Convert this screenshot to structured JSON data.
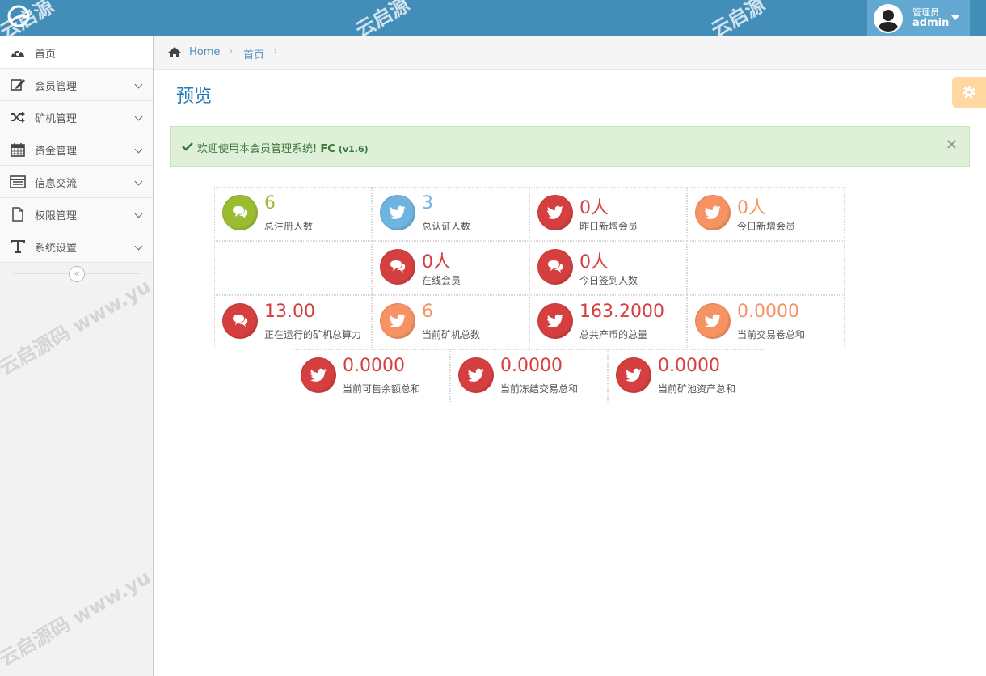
{
  "header": {
    "user_role": "管理员",
    "user_name": "admin"
  },
  "watermarks": [
    "云启源",
    "云启源",
    "云启源",
    "云启源码 www.yu",
    "云启源码 www.yu"
  ],
  "sidebar": {
    "items": [
      {
        "label": "首页",
        "icon": "dashboard-icon"
      },
      {
        "label": "会员管理",
        "icon": "edit-icon"
      },
      {
        "label": "矿机管理",
        "icon": "shuffle-icon"
      },
      {
        "label": "资金管理",
        "icon": "calendar-icon"
      },
      {
        "label": "信息交流",
        "icon": "list-icon"
      },
      {
        "label": "权限管理",
        "icon": "file-icon"
      },
      {
        "label": "系统设置",
        "icon": "text-icon"
      }
    ],
    "collapse_icon": "«"
  },
  "breadcrumb": {
    "home": "Home",
    "current": "首页",
    "separator": "›"
  },
  "page": {
    "title": "预览"
  },
  "alert": {
    "text": "欢迎使用本会员管理系统!",
    "brand": "FC",
    "version": "(v1.6)",
    "close": "×"
  },
  "stats": [
    {
      "value": "6",
      "label": "总注册人数",
      "color": "#9abc32",
      "icon": "comments-icon"
    },
    {
      "value": "3",
      "label": "总认证人数",
      "color": "#6fb3e0",
      "icon": "twitter-icon"
    },
    {
      "value": "0人",
      "label": "昨日新增会员",
      "color": "#d53f40",
      "icon": "twitter-icon"
    },
    {
      "value": "0人",
      "label": "今日新增会员",
      "color": "#f79263",
      "icon": "twitter-icon"
    },
    {
      "value": "0人",
      "label": "在线会员",
      "color": "#d53f40",
      "icon": "comments-icon"
    },
    {
      "value": "0人",
      "label": "今日签到人数",
      "color": "#d53f40",
      "icon": "comments-icon"
    },
    {
      "value": "13.00",
      "label": "正在运行的矿机总算力",
      "color": "#d53f40",
      "icon": "comments-icon"
    },
    {
      "value": "6",
      "label": "当前矿机总数",
      "color": "#f79263",
      "icon": "twitter-icon"
    },
    {
      "value": "163.2000",
      "label": "总共产币的总量",
      "color": "#d53f40",
      "icon": "twitter-icon"
    },
    {
      "value": "0.0000",
      "label": "当前交易卷总和",
      "color": "#f79263",
      "icon": "twitter-icon"
    },
    {
      "value": "0.0000",
      "label": "当前可售余额总和",
      "color": "#d53f40",
      "icon": "twitter-icon"
    },
    {
      "value": "0.0000",
      "label": "当前冻结交易总和",
      "color": "#d53f40",
      "icon": "twitter-icon"
    },
    {
      "value": "0.0000",
      "label": "当前矿池资产总和",
      "color": "#d53f40",
      "icon": "twitter-icon"
    }
  ]
}
